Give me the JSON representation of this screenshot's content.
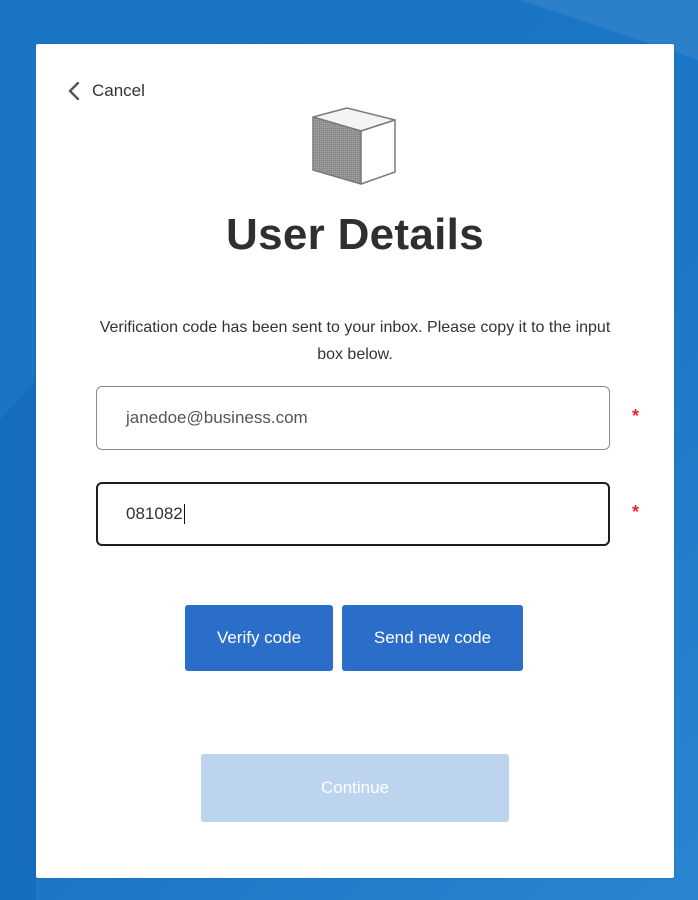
{
  "colors": {
    "background": "#1b76c6",
    "primary_button": "#2b6ec9",
    "disabled_button": "#bdd4ee",
    "required_marker": "#e02a2a"
  },
  "header": {
    "cancel_label": "Cancel",
    "cancel_icon": "chevron-left-icon",
    "logo_icon": "cube-icon",
    "title": "User Details"
  },
  "form": {
    "info_text": "Verification code has been sent to your inbox. Please copy it to the input box below.",
    "email_value": "janedoe@business.com",
    "code_value": "081082",
    "required_marker": "*"
  },
  "actions": {
    "verify_label": "Verify code",
    "send_new_label": "Send new code",
    "continue_label": "Continue"
  }
}
